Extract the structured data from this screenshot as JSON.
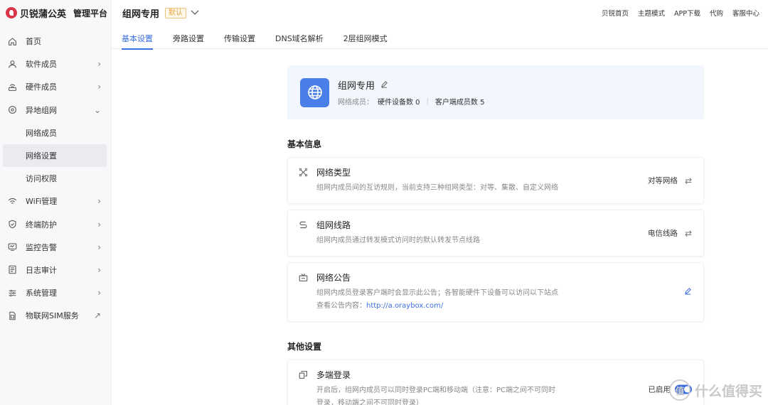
{
  "brand": {
    "name": "贝锐蒲公英",
    "sub": "管理平台"
  },
  "sidebar": {
    "items": [
      {
        "label": "首页",
        "icon": "home-icon",
        "arrow": ""
      },
      {
        "label": "软件成员",
        "icon": "user-icon",
        "arrow": "›"
      },
      {
        "label": "硬件成员",
        "icon": "router-icon",
        "arrow": "›"
      },
      {
        "label": "异地组网",
        "icon": "network-icon",
        "arrow": "⌄"
      },
      {
        "label": "网络成员",
        "icon": "",
        "arrow": ""
      },
      {
        "label": "网络设置",
        "icon": "",
        "arrow": ""
      },
      {
        "label": "访问权限",
        "icon": "",
        "arrow": ""
      },
      {
        "label": "WiFi管理",
        "icon": "wifi-icon",
        "arrow": "›"
      },
      {
        "label": "终端防护",
        "icon": "shield-icon",
        "arrow": "›"
      },
      {
        "label": "监控告警",
        "icon": "monitor-icon",
        "arrow": "›"
      },
      {
        "label": "日志审计",
        "icon": "log-icon",
        "arrow": "›"
      },
      {
        "label": "系统管理",
        "icon": "settings-icon",
        "arrow": "›"
      },
      {
        "label": "物联网SIM服务",
        "icon": "sim-icon",
        "arrow": "↗"
      }
    ]
  },
  "header": {
    "title": "组网专用",
    "badge": "默认",
    "links": [
      "贝锐首页",
      "主题模式",
      "APP下载",
      "代购",
      "客服中心"
    ]
  },
  "tabs": [
    "基本设置",
    "旁路设置",
    "传输设置",
    "DNS域名解析",
    "2层组网模式"
  ],
  "network": {
    "name": "组网专用",
    "members_label": "网络成员：",
    "hardware_count": "硬件设备数 0",
    "client_count": "客户端成员数 5"
  },
  "basic_info": {
    "title": "基本信息",
    "rows": [
      {
        "title": "网络类型",
        "desc": "组网内成员间的互访规则，当前支持三种组网类型：对等、集散、自定义网络",
        "value": "对等网络"
      },
      {
        "title": "组网线路",
        "desc": "组网内成员通过转发模式访问时的默认转发节点线路",
        "value": "电信线路"
      },
      {
        "title": "网络公告",
        "desc": "组网内成员登录客户端时会显示此公告；各智能硬件下设备可以访问以下站点",
        "desc2_prefix": "查看公告内容：",
        "link": "http://a.oraybox.com/"
      }
    ]
  },
  "other_settings": {
    "title": "其他设置",
    "rows": [
      {
        "title": "多端登录",
        "desc": "开启后，组网内成员可以同时登录PC端和移动端（注意：PC端之间不可同时",
        "desc2": "登录，移动端之间不可同时登录）",
        "status": "已启用"
      }
    ]
  },
  "watermark": {
    "text": "什么值得买",
    "badge": "值"
  },
  "colors": {
    "accent": "#3b6ee0",
    "badge": "#e8a33d",
    "icon_bg": "#4a7ee8"
  }
}
